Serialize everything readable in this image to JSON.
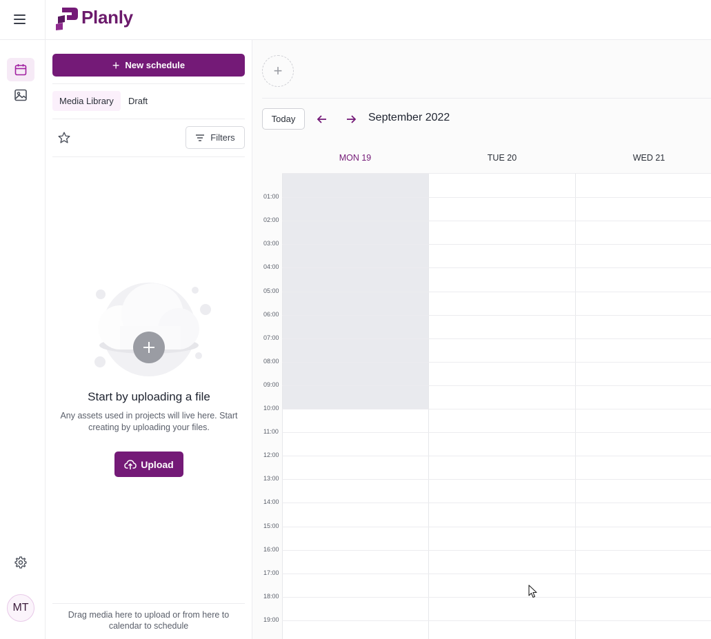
{
  "app": {
    "brand": "Planly",
    "brand_color": "#741a77"
  },
  "rail": {
    "items": [
      {
        "icon": "calendar-icon",
        "active": true
      },
      {
        "icon": "image-icon",
        "active": false
      }
    ],
    "settings_icon": "gear-icon",
    "avatar_initials": "MT"
  },
  "panel": {
    "new_schedule_label": "New schedule",
    "tabs": [
      {
        "label": "Media Library",
        "active": true
      },
      {
        "label": "Draft",
        "active": false
      }
    ],
    "filters_label": "Filters",
    "empty_title": "Start by uploading a file",
    "empty_description": "Any assets used in projects will live here. Start creating by uploading your files.",
    "upload_label": "Upload",
    "drag_hint": "Drag media here to upload or from here to calendar to schedule"
  },
  "calendar": {
    "today_label": "Today",
    "month": "September 2022",
    "days": [
      {
        "label": "MON 19",
        "today": true
      },
      {
        "label": "TUE 20",
        "today": false
      },
      {
        "label": "WED 21",
        "today": false
      }
    ],
    "hours": [
      "01:00",
      "02:00",
      "03:00",
      "04:00",
      "05:00",
      "06:00",
      "07:00",
      "08:00",
      "09:00",
      "10:00",
      "11:00",
      "12:00",
      "13:00",
      "14:00",
      "15:00",
      "16:00",
      "17:00",
      "18:00",
      "19:00"
    ]
  }
}
